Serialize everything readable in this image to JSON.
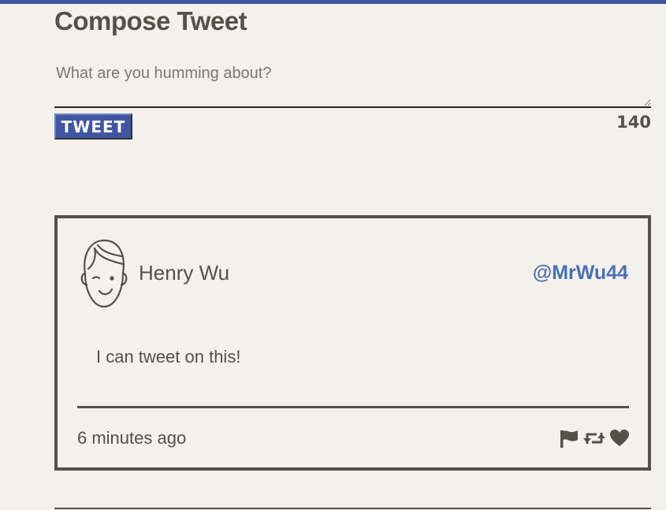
{
  "compose": {
    "title": "Compose Tweet",
    "placeholder": "What are you humming about?",
    "value": "",
    "button_label": "TWEET",
    "char_count": "140"
  },
  "tweet": {
    "author_name": "Henry Wu",
    "handle": "@MrWu44",
    "text": "I can tweet on this!",
    "timestamp": "6 minutes ago",
    "actions": [
      "flag-icon",
      "retweet-icon",
      "heart-icon"
    ]
  },
  "colors": {
    "accent": "#4056a1",
    "handle": "#4a6fb5",
    "text": "#545149",
    "background": "#f4f1ec"
  }
}
